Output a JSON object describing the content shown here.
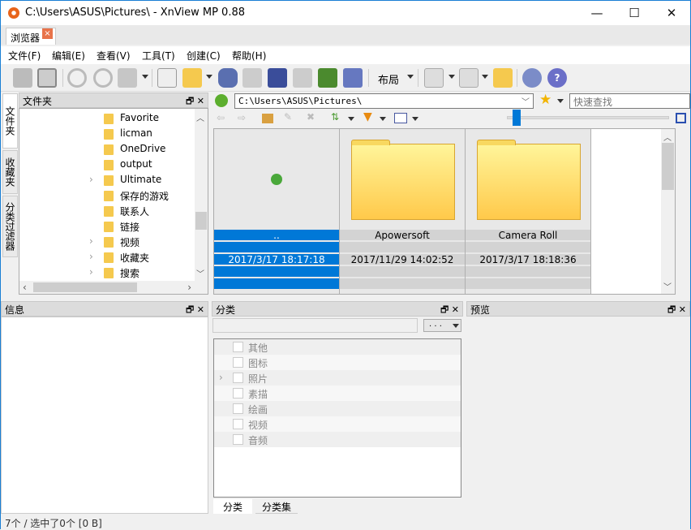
{
  "window": {
    "title": "C:\\Users\\ASUS\\Pictures\\ - XnView MP 0.88",
    "minimize": "—",
    "maximize": "☐",
    "close": "✕"
  },
  "tabs": [
    {
      "label": "浏览器",
      "close": "×"
    }
  ],
  "menu": [
    "文件(F)",
    "编辑(E)",
    "查看(V)",
    "工具(T)",
    "创建(C)",
    "帮助(H)"
  ],
  "toolbar": {
    "layout_label": "布局"
  },
  "side_tabs": [
    "文件夹",
    "收藏夹",
    "分类过滤器"
  ],
  "folder_panel": {
    "title": "文件夹",
    "items": [
      {
        "label": "Favorite",
        "expandable": false
      },
      {
        "label": "licman",
        "expandable": false
      },
      {
        "label": "OneDrive",
        "expandable": false
      },
      {
        "label": "output",
        "expandable": false
      },
      {
        "label": "Ultimate",
        "expandable": true
      },
      {
        "label": "保存的游戏",
        "expandable": false
      },
      {
        "label": "联系人",
        "expandable": false
      },
      {
        "label": "链接",
        "expandable": false
      },
      {
        "label": "视频",
        "expandable": true
      },
      {
        "label": "收藏夹",
        "expandable": true
      },
      {
        "label": "搜索",
        "expandable": true
      }
    ]
  },
  "address": {
    "path": "C:\\Users\\ASUS\\Pictures\\",
    "search_placeholder": "快速查找"
  },
  "thumbnails": [
    {
      "name": "..",
      "date": "2017/3/17 18:17:18",
      "selected": true,
      "type": "parent"
    },
    {
      "name": "Apowersoft",
      "date": "2017/11/29 14:02:52",
      "selected": false,
      "type": "folder"
    },
    {
      "name": "Camera Roll",
      "date": "2017/3/17 18:18:36",
      "selected": false,
      "type": "folder"
    }
  ],
  "info_panel": {
    "title": "信息"
  },
  "category_panel": {
    "title": "分类",
    "filter_button": ". . .",
    "items": [
      "其他",
      "图标",
      "照片",
      "素描",
      "绘画",
      "视频",
      "音频"
    ],
    "expandable_item": "照片",
    "tabs": [
      "分类",
      "分类集"
    ]
  },
  "preview_panel": {
    "title": "预览"
  },
  "status": "7个 / 选中了0个 [0 B]",
  "colors": {
    "selection": "#0078d7",
    "window_border": "#1a7fd4"
  }
}
